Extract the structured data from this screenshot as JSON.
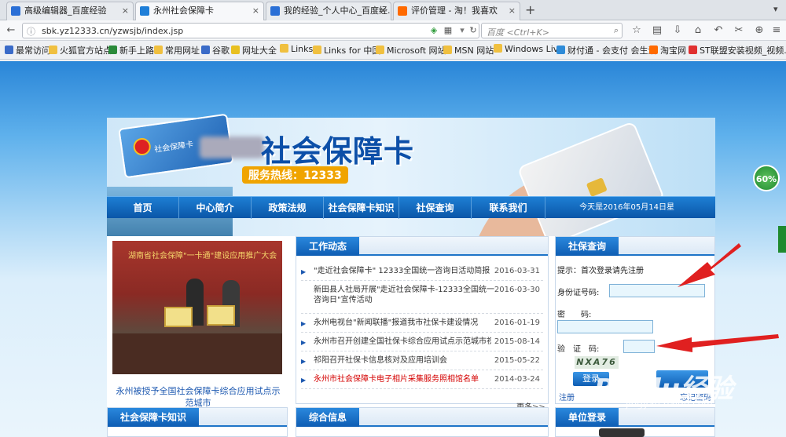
{
  "browser": {
    "tabs": [
      {
        "label": "高级编辑器_百度经验",
        "color": "#2a6fd6"
      },
      {
        "label": "永州社会保障卡",
        "color": "#1f7fd8"
      },
      {
        "label": "我的经验_个人中心_百度经...",
        "color": "#2a6fd6"
      },
      {
        "label": "评价管理 - 淘！我喜欢",
        "color": "#ff6a00"
      }
    ],
    "url": "sbk.yz12333.cn/yzwsjb/index.jsp",
    "search_placeholder": "百度 <Ctrl+K>",
    "bookmarks": [
      "最常访问",
      "火狐官方站点",
      "新手上路",
      "常用网址",
      "谷歌",
      "网址大全",
      "Links",
      "Links for 中国",
      "Microsoft 网站",
      "MSN 网站",
      "Windows Live",
      "财付通 - 会支付 会生活",
      "淘宝网",
      "ST联盟安装视频_视频..."
    ]
  },
  "site": {
    "title": "社会保障卡",
    "card_label": "社会保障卡",
    "hotline": "服务热线：12333",
    "badge": "60%",
    "menu": [
      "首页",
      "中心简介",
      "政策法规",
      "社会保障卡知识",
      "社保查询",
      "联系我们"
    ],
    "today": "今天是2016年05月14日星",
    "photo_sign": "湖南省社会保障\"一卡通\"建设应用推广大会",
    "photo_caption": "永州被授予全国社会保障卡综合应用试点示范城市",
    "news_title": "工作动态",
    "news": [
      {
        "text": "\"走近社会保障卡\" 12333全国统一咨询日活动简报",
        "date": "2016-03-31"
      },
      {
        "text": "新田县人社局开展\"走近社会保障卡-12333全国统一咨询日\"宣传活动",
        "date": "2016-03-30"
      },
      {
        "text": "永州电视台\"新闻联播\"报道我市社保卡建设情况",
        "date": "2016-01-19"
      },
      {
        "text": "永州市召开创建全国社保卡综合应用试点示范城市视频会",
        "date": "2015-08-14"
      },
      {
        "text": "祁阳召开社保卡信息核对及应用培训会",
        "date": "2015-05-22"
      },
      {
        "text": "永州市社会保障卡电子相片采集服务照相馆名单",
        "date": "2014-03-24"
      }
    ],
    "more": "更多>>",
    "query_title": "社保查询",
    "query_prompt": "提示：首次登录请先注册",
    "id_label": "身份证号码:",
    "pwd_label": "密　　码:",
    "captcha_label": "验　证　码:",
    "captcha": "NXA76",
    "login": "登录",
    "register": "注册",
    "forgot": "忘记密码",
    "card_knowledge": "社会保障卡知识",
    "info_title": "综合信息",
    "unit_login": "单位登录",
    "watermark": "Baidu经验",
    "watermark_url": "jingyan.baidu.com"
  }
}
